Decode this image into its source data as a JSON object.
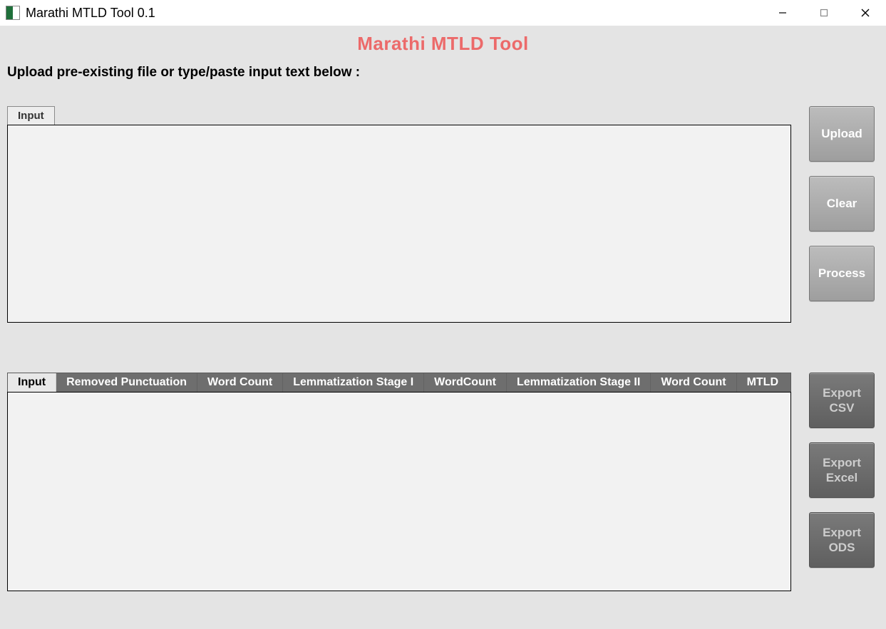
{
  "window": {
    "title": "Marathi MTLD Tool 0.1"
  },
  "heading": "Marathi MTLD Tool",
  "instruction": "Upload pre-existing file or type/paste input text below :",
  "input_panel": {
    "tab_label": "Input",
    "value": ""
  },
  "output_panel": {
    "tabs": [
      "Input",
      "Removed Punctuation",
      "Word Count",
      "Lemmatization Stage I",
      "WordCount",
      "Lemmatization Stage II",
      "Word Count",
      "MTLD"
    ],
    "active_tab_index": 0
  },
  "buttons_primary": {
    "upload": "Upload",
    "clear": "Clear",
    "process": "Process"
  },
  "buttons_export": {
    "csv": "Export CSV",
    "excel": "Export Excel",
    "ods": "Export ODS"
  }
}
